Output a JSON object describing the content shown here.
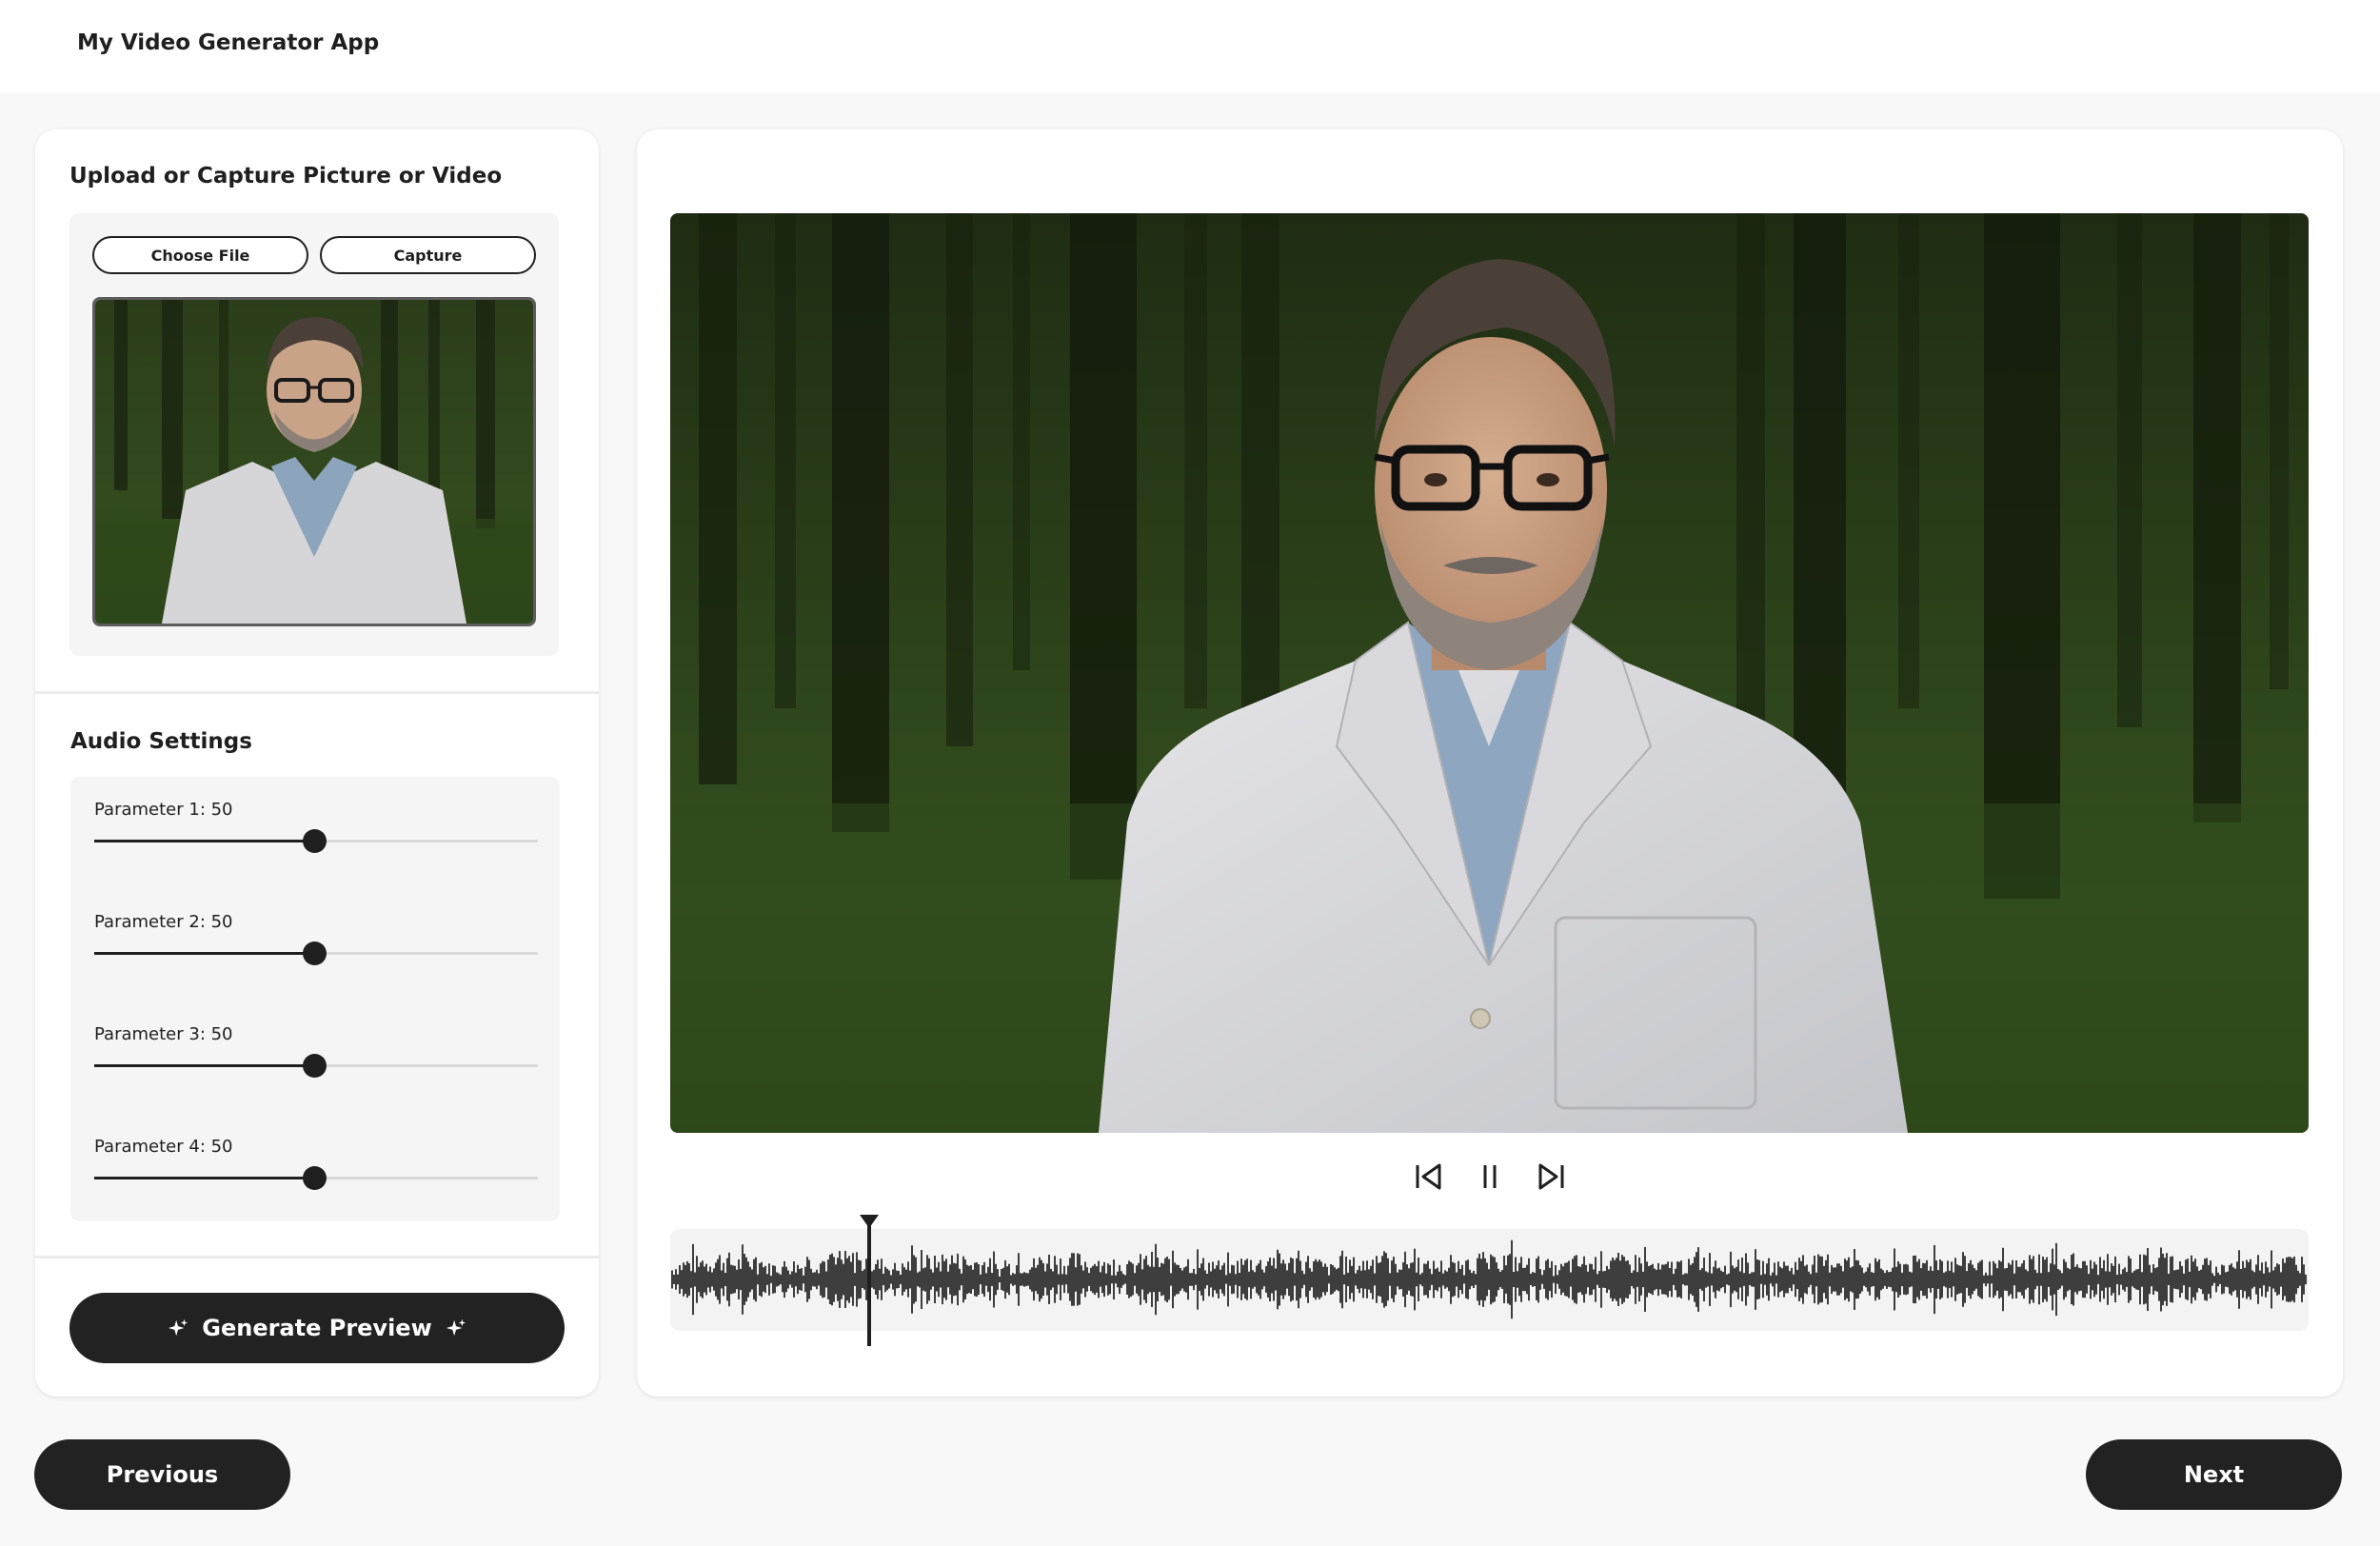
{
  "app": {
    "title": "My Video Generator App"
  },
  "upload": {
    "title": "Upload or Capture Picture or Video",
    "choose_file_label": "Choose File",
    "capture_label": "Capture"
  },
  "audio": {
    "title": "Audio Settings",
    "parameters": [
      {
        "label": "Parameter 1: 50",
        "value": 50,
        "max": 100
      },
      {
        "label": "Parameter 2: 50",
        "value": 50,
        "max": 100
      },
      {
        "label": "Parameter 3: 50",
        "value": 50,
        "max": 100
      },
      {
        "label": "Parameter 4: 50",
        "value": 50,
        "max": 100
      }
    ]
  },
  "generate": {
    "label": "Generate Preview",
    "icon": "sparkle-icon"
  },
  "player": {
    "controls": [
      "skip-back-icon",
      "pause-icon",
      "skip-forward-icon"
    ],
    "playhead_fraction": 0.125
  },
  "navigation": {
    "previous_label": "Previous",
    "next_label": "Next"
  },
  "colors": {
    "accent": "#222222",
    "background": "#f8f8f8",
    "card": "#ffffff",
    "forest_dark": "#1d2a12",
    "forest_mid": "#3e5a22"
  }
}
